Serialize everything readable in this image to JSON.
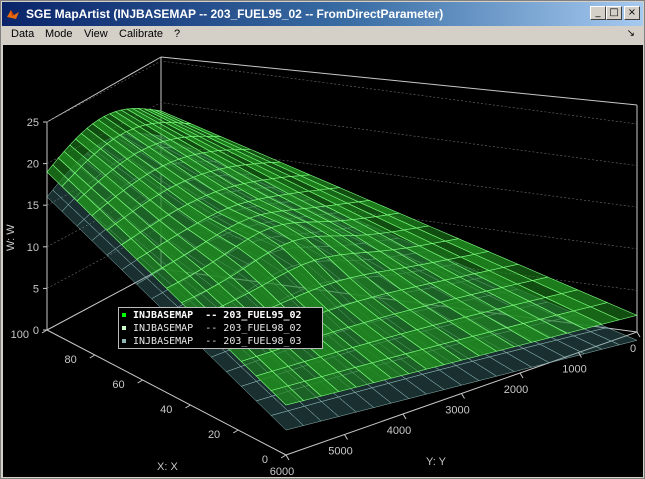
{
  "window": {
    "title": "SGE MapArtist (INJBASEMAP -- 203_FUEL95_02 -- FromDirectParameter)",
    "controls": {
      "minimize": "_",
      "maximize": "□",
      "close": "×"
    }
  },
  "menu": {
    "items": [
      "Data",
      "Mode",
      "View",
      "Calibrate",
      "?"
    ],
    "corner_icon": "↘"
  },
  "colors": {
    "plot_background": "#000000",
    "axis": "#c8c8c8",
    "surface_fill": "#1f8a1f",
    "surface_mesh": "#7cff7c",
    "series_1": "#00ff00",
    "series_2": "#ccffcc",
    "series_3": "#8fb6b6"
  },
  "chart_data": {
    "type": "surface",
    "zlabel": "W:  W",
    "xlabel": "X:  X",
    "ylabel": "Y:  Y",
    "z_ticks": [
      "0",
      "5",
      "10",
      "15",
      "20",
      "25"
    ],
    "x_ticks": [
      "0",
      "20",
      "40",
      "60",
      "80",
      "100"
    ],
    "y_ticks": [
      "0",
      "1000",
      "2000",
      "3000",
      "4000",
      "5000",
      "6000"
    ],
    "zlim": [
      0,
      25
    ],
    "xlim": [
      0,
      100
    ],
    "ylim": [
      0,
      6000
    ],
    "grid": true,
    "legend_placement": "center-left",
    "series": [
      {
        "name": "INJBASEMAP  -- 203_FUEL95_02",
        "color": "#00ff00",
        "bold": true
      },
      {
        "name": "INJBASEMAP  -- 203_FUEL98_02",
        "color": "#ccffcc",
        "bold": false
      },
      {
        "name": "INJBASEMAP  -- 203_FUEL98_03",
        "color": "#8fb6b6",
        "bold": false
      }
    ]
  }
}
